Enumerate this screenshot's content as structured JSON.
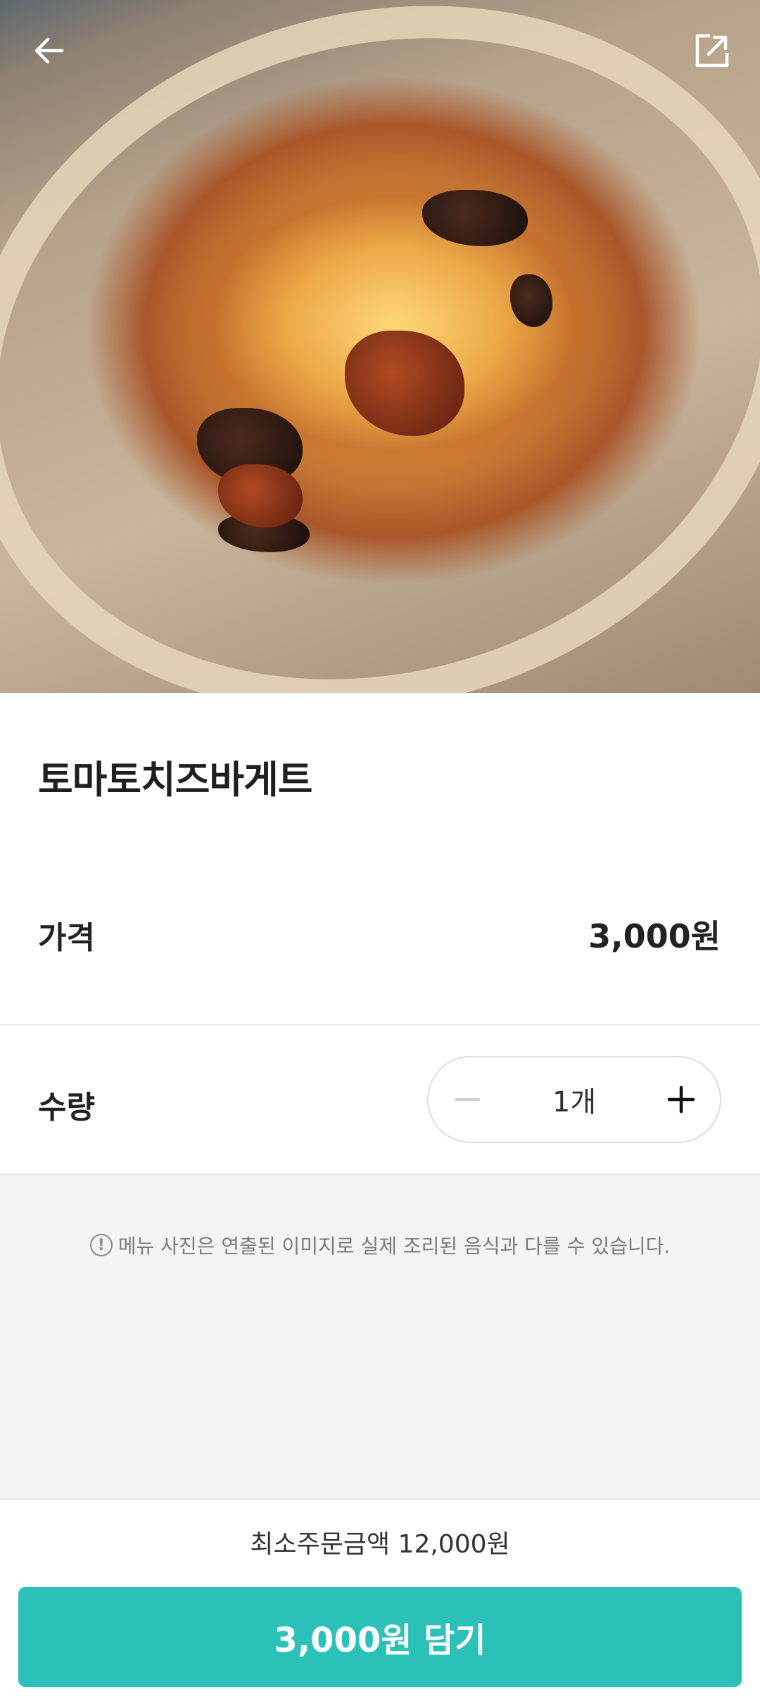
{
  "product": {
    "name": "토마토치즈바게트"
  },
  "price": {
    "label": "가격",
    "value": "3,000원"
  },
  "quantity": {
    "label": "수량",
    "value": "1개"
  },
  "notice": {
    "text": "메뉴 사진은 연출된 이미지로 실제 조리된 음식과 다를 수 있습니다."
  },
  "footer": {
    "min_order": "최소주문금액 12,000원",
    "add_button": "3,000원 담기"
  },
  "icons": {
    "back": "arrow-left-icon",
    "share": "share-external-icon",
    "minus": "minus-icon",
    "plus": "plus-icon",
    "info": "exclamation-circle-icon"
  },
  "colors": {
    "accent": "#2bc1b9",
    "notice_bg": "#f4f4f4"
  }
}
